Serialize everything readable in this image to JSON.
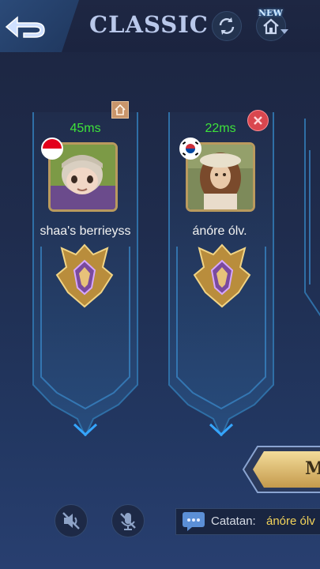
{
  "header": {
    "title": "CLASSIC",
    "back_icon": "back-arrow-icon",
    "refresh_icon": "refresh-icon",
    "home_icon": "home-icon",
    "new_badge": "NEW"
  },
  "players": [
    {
      "ping": "45ms",
      "name": "shaa's berrieyss",
      "flag": "Indonesia",
      "role_icon": "host-icon",
      "rank_icon": "mythic-rank-icon"
    },
    {
      "ping": "22ms",
      "name": "ánóre ólv.",
      "flag": "South Korea",
      "role_icon": "kick-icon",
      "rank_icon": "mythic-rank-icon"
    }
  ],
  "match_button": {
    "label": "M"
  },
  "voice": {
    "speaker_icon": "speaker-muted-icon",
    "mic_icon": "mic-muted-icon"
  },
  "chat": {
    "icon": "chat-icon",
    "prefix": "Catatan:",
    "name": "ánóre ólv"
  },
  "colors": {
    "ping": "#3ee23a",
    "chat_name": "#f4d45a",
    "title": "#b9c8ea",
    "frame": "#2f86c9"
  }
}
